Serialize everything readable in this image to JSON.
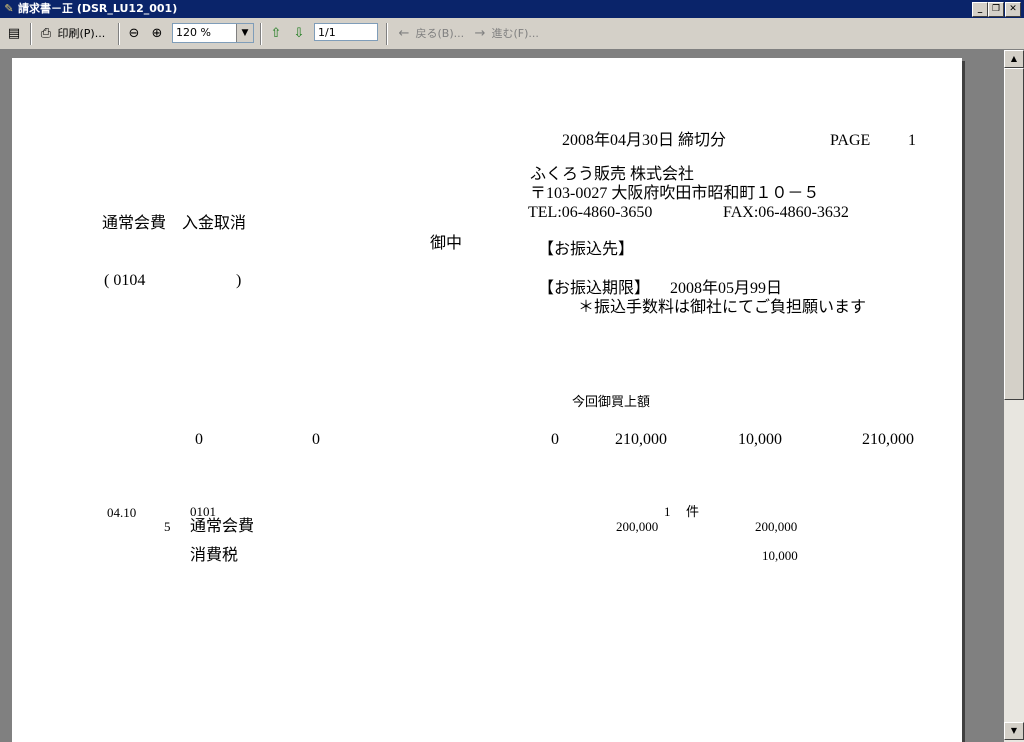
{
  "window": {
    "title": "請求書－正 (DSR_LU12_001)",
    "minimize": "_",
    "restore": "❐",
    "close": "✕"
  },
  "toolbar": {
    "print_label": "印刷(P)...",
    "zoom_value": "120 %",
    "page_value": "1/1",
    "back_label": "戻る(B)...",
    "forward_label": "進む(F)..."
  },
  "doc": {
    "date_line": "2008年04月30日 締切分",
    "page_label": "PAGE",
    "page_number": "1",
    "company_name": "ふくろう販売 株式会社",
    "address": "〒103-0027 大阪府吹田市昭和町１０－５",
    "tel": "TEL:06-4860-3650",
    "fax": "FAX:06-4860-3632",
    "customer_name": "通常会費　入金取消",
    "honorific": "御中",
    "customer_code_open": "( 0104",
    "customer_code_close": ")",
    "transfer_to": "【お振込先】",
    "transfer_deadline_label": "【お振込期限】",
    "transfer_deadline": "2008年05月99日",
    "fee_note": "＊振込手数料は御社にてご負担願います",
    "purchase_header": "今回御買上額",
    "summary": {
      "v1": "0",
      "v2": "0",
      "v3": "0",
      "v4": "210,000",
      "v5": "10,000",
      "v6": "210,000"
    },
    "line_items": [
      {
        "date": "04.10",
        "slip": "0101",
        "count": "1",
        "count_unit": "件"
      },
      {
        "seq": "5",
        "name": "通常会費",
        "unit_price": "200,000",
        "amount": "200,000"
      },
      {
        "name": "消費税",
        "amount": "10,000"
      }
    ]
  }
}
